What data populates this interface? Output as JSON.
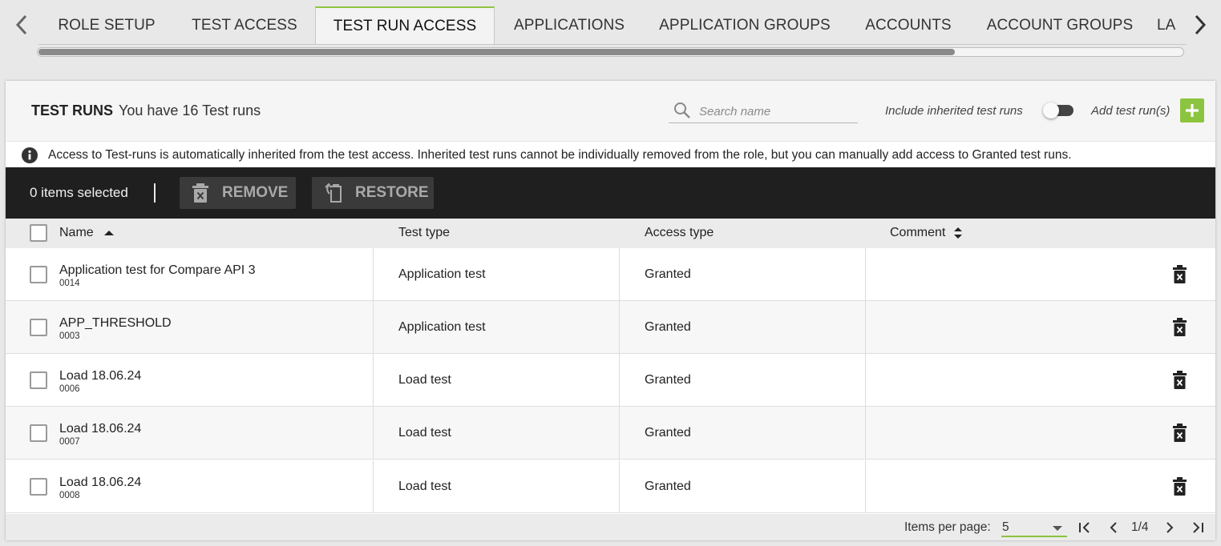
{
  "tabs": [
    {
      "label": "ROLE SETUP",
      "active": false
    },
    {
      "label": "TEST ACCESS",
      "active": false
    },
    {
      "label": "TEST RUN ACCESS",
      "active": true
    },
    {
      "label": "APPLICATIONS",
      "active": false
    },
    {
      "label": "APPLICATION GROUPS",
      "active": false
    },
    {
      "label": "ACCOUNTS",
      "active": false
    },
    {
      "label": "ACCOUNT GROUPS",
      "active": false
    },
    {
      "label": "LA",
      "active": false
    }
  ],
  "header": {
    "title": "TEST RUNS",
    "count_text": "You have 16 Test runs",
    "search_placeholder": "Search name",
    "search_value": "",
    "inherit_label": "Include inherited test runs",
    "inherit_toggle_on": false,
    "add_label": "Add test run(s)"
  },
  "info": {
    "text": "Access to Test-runs is automatically inherited from the test access. Inherited test runs cannot be individually removed from the role, but you can manually add access to Granted test runs."
  },
  "actions": {
    "selected_text": "0 items selected",
    "remove_label": "REMOVE",
    "restore_label": "RESTORE"
  },
  "table": {
    "columns": {
      "name": "Name",
      "test_type": "Test type",
      "access_type": "Access type",
      "comment": "Comment"
    },
    "rows": [
      {
        "name": "Application test for Compare API 3",
        "id": "0014",
        "test_type": "Application test",
        "access_type": "Granted",
        "comment": ""
      },
      {
        "name": "APP_THRESHOLD",
        "id": "0003",
        "test_type": "Application test",
        "access_type": "Granted",
        "comment": ""
      },
      {
        "name": "Load 18.06.24",
        "id": "0006",
        "test_type": "Load test",
        "access_type": "Granted",
        "comment": ""
      },
      {
        "name": "Load 18.06.24",
        "id": "0007",
        "test_type": "Load test",
        "access_type": "Granted",
        "comment": ""
      },
      {
        "name": "Load 18.06.24",
        "id": "0008",
        "test_type": "Load test",
        "access_type": "Granted",
        "comment": ""
      }
    ]
  },
  "pagination": {
    "items_per_page_label": "Items per page:",
    "items_per_page": "5",
    "page_text": "1/4"
  },
  "colors": {
    "accent": "#8cc43f",
    "action_bar": "#1f1f1f"
  }
}
